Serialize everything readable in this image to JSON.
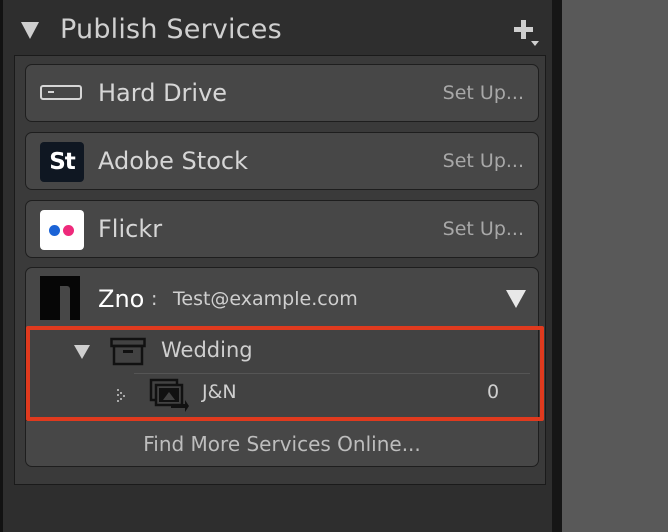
{
  "header": {
    "title": "Publish Services",
    "collapse_icon": "disclosure-triangle-down",
    "add_icon": "plus-with-dropdown"
  },
  "services": [
    {
      "name": "Hard Drive",
      "action": "Set Up...",
      "icon": "hard-drive-icon"
    },
    {
      "name": "Adobe Stock",
      "action": "Set Up...",
      "icon": "adobe-stock-icon",
      "icon_text": "St"
    },
    {
      "name": "Flickr",
      "action": "Set Up...",
      "icon": "flickr-icon"
    }
  ],
  "zno": {
    "name": "Zno",
    "separator": ":",
    "account": "Test@example.com",
    "icon": "zno-logo",
    "expand_icon": "disclosure-triangle-down"
  },
  "collections": {
    "set": {
      "label": "Wedding",
      "icon": "collection-set-box-icon"
    },
    "items": [
      {
        "label": "J&N",
        "count": "0",
        "icon": "smart-collection-icon"
      }
    ]
  },
  "footer": {
    "find_more": "Find More Services Online..."
  },
  "colors": {
    "highlight": "#e03a1e",
    "panel_bg": "#2e2e2e",
    "row_bg": "#474747"
  }
}
